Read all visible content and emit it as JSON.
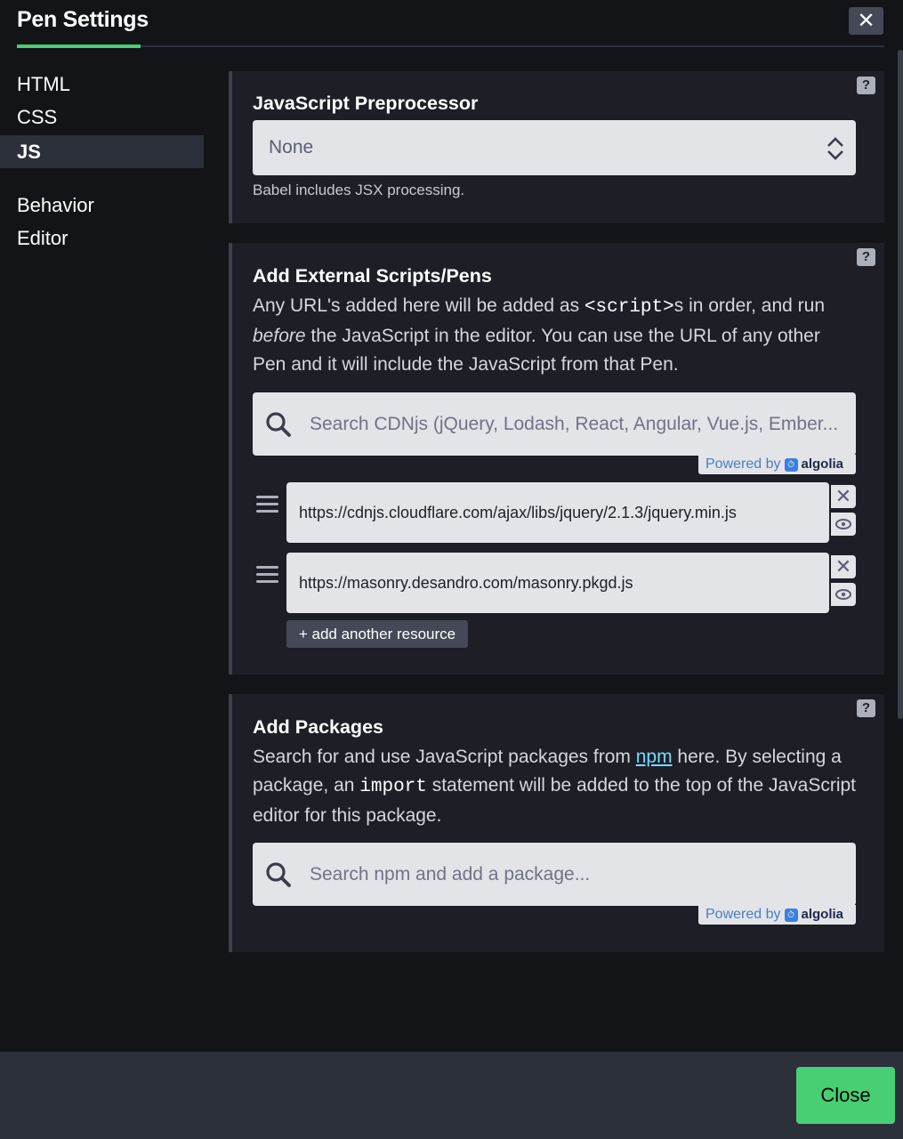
{
  "header": {
    "title": "Pen Settings",
    "close_glyph": "✕",
    "accent_color": "#47cf73"
  },
  "sidebar": {
    "items": [
      {
        "label": "HTML",
        "active": false
      },
      {
        "label": "CSS",
        "active": false
      },
      {
        "label": "JS",
        "active": true
      },
      {
        "label": "Behavior",
        "active": false
      },
      {
        "label": "Editor",
        "active": false
      }
    ]
  },
  "preprocessor": {
    "heading": "JavaScript Preprocessor",
    "selected": "None",
    "note": "Babel includes JSX processing.",
    "help": "?"
  },
  "external": {
    "heading": "Add External Scripts/Pens",
    "desc_part1": "Any URL's added here will be added as ",
    "desc_code": "<script>",
    "desc_part2": "s in order, and run ",
    "desc_italic": "before",
    "desc_part3": " the JavaScript in the editor. You can use the URL of any other Pen and it will include the JavaScript from that Pen.",
    "search_placeholder": "Search CDNjs (jQuery, Lodash, React, Angular, Vue.js, Ember...",
    "powered_by": "Powered by",
    "algolia": "algolia",
    "resources": [
      "https://cdnjs.cloudflare.com/ajax/libs/jquery/2.1.3/jquery.min.js",
      "https://masonry.desandro.com/masonry.pkgd.js"
    ],
    "remove_glyph": "✕",
    "add_label": "+ add another resource",
    "help": "?"
  },
  "packages": {
    "heading": "Add Packages",
    "desc_part1": "Search for and use JavaScript packages from ",
    "desc_link": "npm",
    "desc_part2": " here. By selecting a package, an ",
    "desc_code": "import",
    "desc_part3": " statement will be added to the top of the JavaScript editor for this package.",
    "search_placeholder": "Search npm and add a package...",
    "powered_by": "Powered by",
    "algolia": "algolia",
    "help": "?"
  },
  "footer": {
    "close_label": "Close"
  }
}
